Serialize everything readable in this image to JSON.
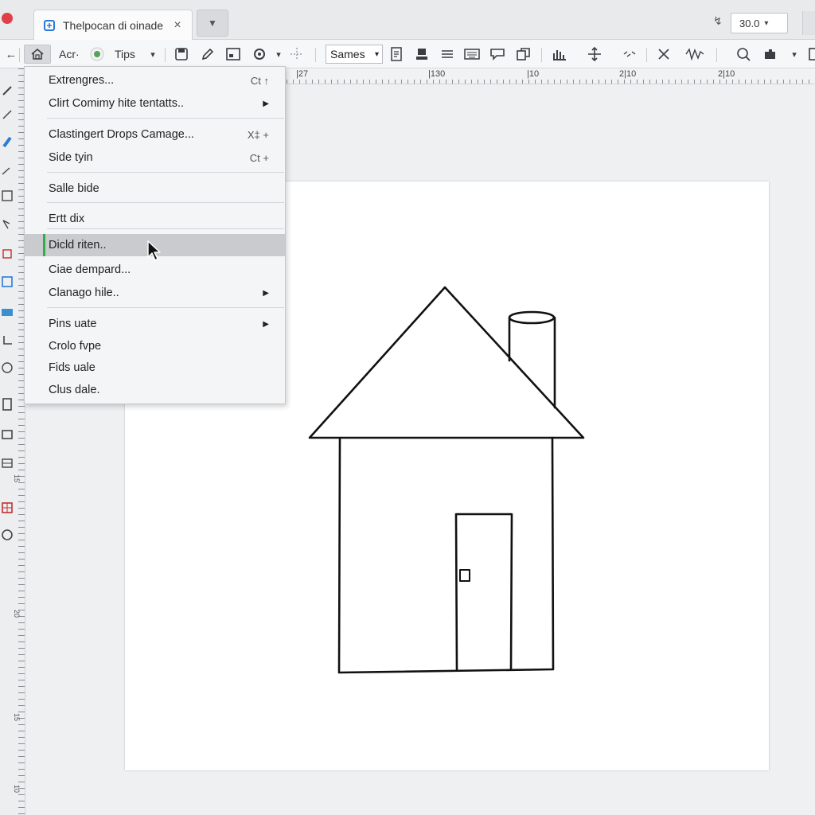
{
  "window": {
    "tab_title": "Thelpocan di oinade",
    "close_glyph": "×",
    "tab_menu_glyph": "▼",
    "zoom_value": "30.0",
    "zoom_caret": "▾",
    "zoom_icon": "↯"
  },
  "toolbar": {
    "back_glyph": "←",
    "home_icon": "home-icon",
    "acr_label": "Acr·",
    "tips_label": "Tips",
    "caret": "▾",
    "font_value": "Sames",
    "font_caret": "▾"
  },
  "ruler": {
    "top_labels": [
      "|27",
      "|130",
      "|10",
      "2|10",
      "2|10"
    ],
    "left_labels": [
      "15",
      "20",
      "15",
      "10"
    ]
  },
  "menu": {
    "items": [
      {
        "label": "Extrengres...",
        "shortcut": "Ct ↑"
      },
      {
        "label": "Clirt Comimy hite tentatts..",
        "arrow": "▶"
      },
      {
        "label": "Clastingert Drops Camage...",
        "shortcut": "X‡ +"
      },
      {
        "label": "Side tyin",
        "shortcut": "Ct +"
      },
      {
        "label": "Salle bide"
      },
      {
        "label": "Ertt dix"
      },
      {
        "label": "Dicld riten.."
      },
      {
        "label": "Ciae dempard..."
      },
      {
        "label": "Clanago hile..",
        "arrow": "▶"
      },
      {
        "label": "Pins uate",
        "arrow": "▶"
      },
      {
        "label": "Crolo fvpe"
      },
      {
        "label": "Fids uale"
      },
      {
        "label": "Clus dale."
      }
    ],
    "hovered_index": 6
  },
  "colors": {
    "accent_green": "#2fae4a",
    "tab_icon_blue": "#2b7ad8",
    "window_close_red": "#e0404a"
  },
  "drawing": {
    "subject": "house-with-chimney-and-door"
  }
}
